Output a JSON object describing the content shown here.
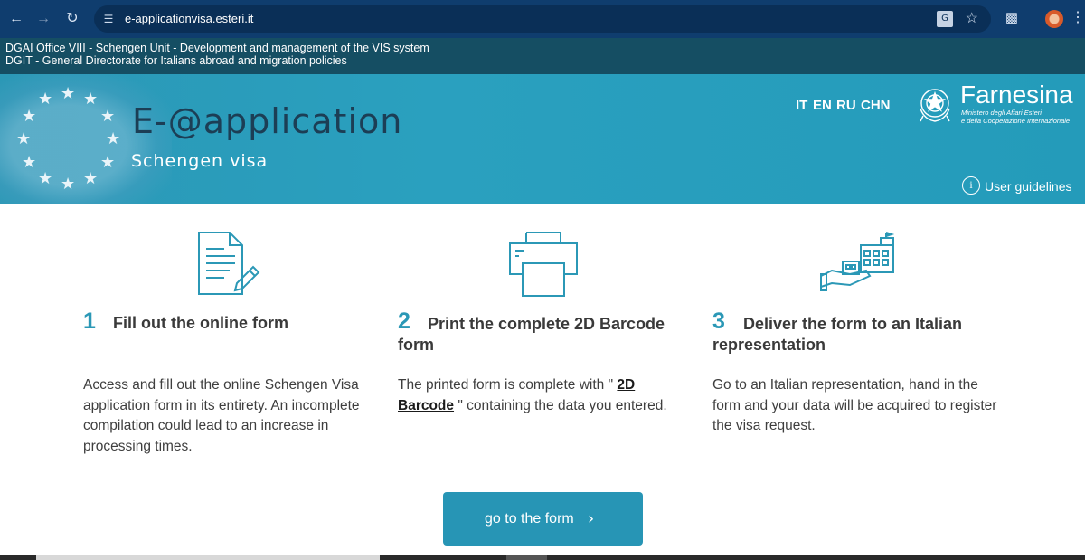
{
  "browser": {
    "url": "e-applicationvisa.esteri.it",
    "icons": [
      "back-icon",
      "forward-icon",
      "reload-icon",
      "site-settings-icon",
      "translate-icon",
      "star-icon",
      "extensions-icon",
      "profile-icon",
      "menu-icon"
    ]
  },
  "info_bar": {
    "line1": "DGAI Office VIII - Schengen Unit - Development and management of the VIS system",
    "line2": "DGIT - General Directorate for Italians abroad and migration policies"
  },
  "header": {
    "app_title": "E-@application",
    "app_subtitle": "Schengen visa",
    "languages": [
      "IT",
      "EN",
      "RU",
      "CHN"
    ],
    "brand": "Farnesina",
    "brand_sub_1": "Ministero degli Affari Esteri",
    "brand_sub_2": "e della Cooperazione Internazionale",
    "guidelines_label": "User guidelines"
  },
  "steps": [
    {
      "number": "1",
      "title": "Fill out the online form",
      "text": "Access and fill out the online Schengen Visa application form in its entirety. An incomplete compilation could lead to an increase in processing times.",
      "icon": "document-pen-icon"
    },
    {
      "number": "2",
      "title": "Print the complete 2D Barcode form",
      "text_before": "The printed form is complete with \"",
      "link": "2D Barcode",
      "text_after": "\" containing the data you entered.",
      "icon": "printer-icon"
    },
    {
      "number": "3",
      "title": "Deliver the form to an Italian representation",
      "text": "Go to an Italian representation, hand in the form and your data will be acquired to register the visa request.",
      "icon": "hand-building-icon"
    }
  ],
  "cta": {
    "label": "go to the form"
  },
  "colors": {
    "accent": "#2b98b6",
    "browser_bar": "#0f3d6e",
    "info_bar": "#154e63"
  }
}
